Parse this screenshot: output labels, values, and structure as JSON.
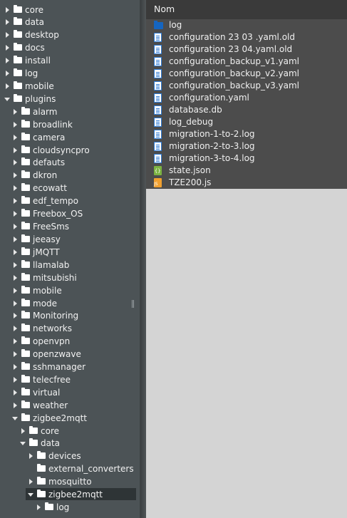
{
  "tree": {
    "items": [
      {
        "label": "core",
        "state": "closed"
      },
      {
        "label": "data",
        "state": "closed"
      },
      {
        "label": "desktop",
        "state": "closed"
      },
      {
        "label": "docs",
        "state": "closed"
      },
      {
        "label": "install",
        "state": "closed"
      },
      {
        "label": "log",
        "state": "closed"
      },
      {
        "label": "mobile",
        "state": "closed"
      },
      {
        "label": "plugins",
        "state": "open"
      },
      {
        "label": "alarm",
        "state": "closed"
      },
      {
        "label": "broadlink",
        "state": "closed"
      },
      {
        "label": "camera",
        "state": "closed"
      },
      {
        "label": "cloudsyncpro",
        "state": "closed"
      },
      {
        "label": "defauts",
        "state": "closed"
      },
      {
        "label": "dkron",
        "state": "closed"
      },
      {
        "label": "ecowatt",
        "state": "closed"
      },
      {
        "label": "edf_tempo",
        "state": "closed"
      },
      {
        "label": "Freebox_OS",
        "state": "closed"
      },
      {
        "label": "FreeSms",
        "state": "closed"
      },
      {
        "label": "jeeasy",
        "state": "closed"
      },
      {
        "label": "jMQTT",
        "state": "closed"
      },
      {
        "label": "llamalab",
        "state": "closed"
      },
      {
        "label": "mitsubishi",
        "state": "closed"
      },
      {
        "label": "mobile",
        "state": "closed"
      },
      {
        "label": "mode",
        "state": "closed"
      },
      {
        "label": "Monitoring",
        "state": "closed"
      },
      {
        "label": "networks",
        "state": "closed"
      },
      {
        "label": "openvpn",
        "state": "closed"
      },
      {
        "label": "openzwave",
        "state": "closed"
      },
      {
        "label": "sshmanager",
        "state": "closed"
      },
      {
        "label": "telecfree",
        "state": "closed"
      },
      {
        "label": "virtual",
        "state": "closed"
      },
      {
        "label": "weather",
        "state": "closed"
      },
      {
        "label": "zigbee2mqtt",
        "state": "open"
      },
      {
        "label": "core",
        "state": "closed"
      },
      {
        "label": "data",
        "state": "open"
      },
      {
        "label": "devices",
        "state": "closed"
      },
      {
        "label": "external_converters",
        "state": "none"
      },
      {
        "label": "mosquitto",
        "state": "closed"
      },
      {
        "label": "zigbee2mqtt",
        "state": "open",
        "selected": true
      },
      {
        "label": "log",
        "state": "closed"
      }
    ]
  },
  "files": {
    "header": "Nom",
    "items": [
      {
        "label": "log",
        "icon": "folder-icon"
      },
      {
        "label": "configuration 23 03 .yaml.old",
        "icon": "document-icon"
      },
      {
        "label": "configuration 23 04.yaml.old",
        "icon": "document-icon"
      },
      {
        "label": "configuration_backup_v1.yaml",
        "icon": "document-icon"
      },
      {
        "label": "configuration_backup_v2.yaml",
        "icon": "document-icon"
      },
      {
        "label": "configuration_backup_v3.yaml",
        "icon": "document-icon"
      },
      {
        "label": "configuration.yaml",
        "icon": "document-icon"
      },
      {
        "label": "database.db",
        "icon": "document-icon"
      },
      {
        "label": "log_debug",
        "icon": "document-icon"
      },
      {
        "label": "migration-1-to-2.log",
        "icon": "document-icon"
      },
      {
        "label": "migration-2-to-3.log",
        "icon": "document-icon"
      },
      {
        "label": "migration-3-to-4.log",
        "icon": "document-icon"
      },
      {
        "label": "state.json",
        "icon": "json-file-icon"
      },
      {
        "label": "TZE200.js",
        "icon": "js-file-icon"
      }
    ]
  },
  "colors": {
    "tree_bg": "#4c5356",
    "files_bg": "#4c4c4c",
    "header_bg": "#3a3a3a",
    "empty_bg": "#d4d4d4",
    "folder_blue": "#1565c0"
  }
}
